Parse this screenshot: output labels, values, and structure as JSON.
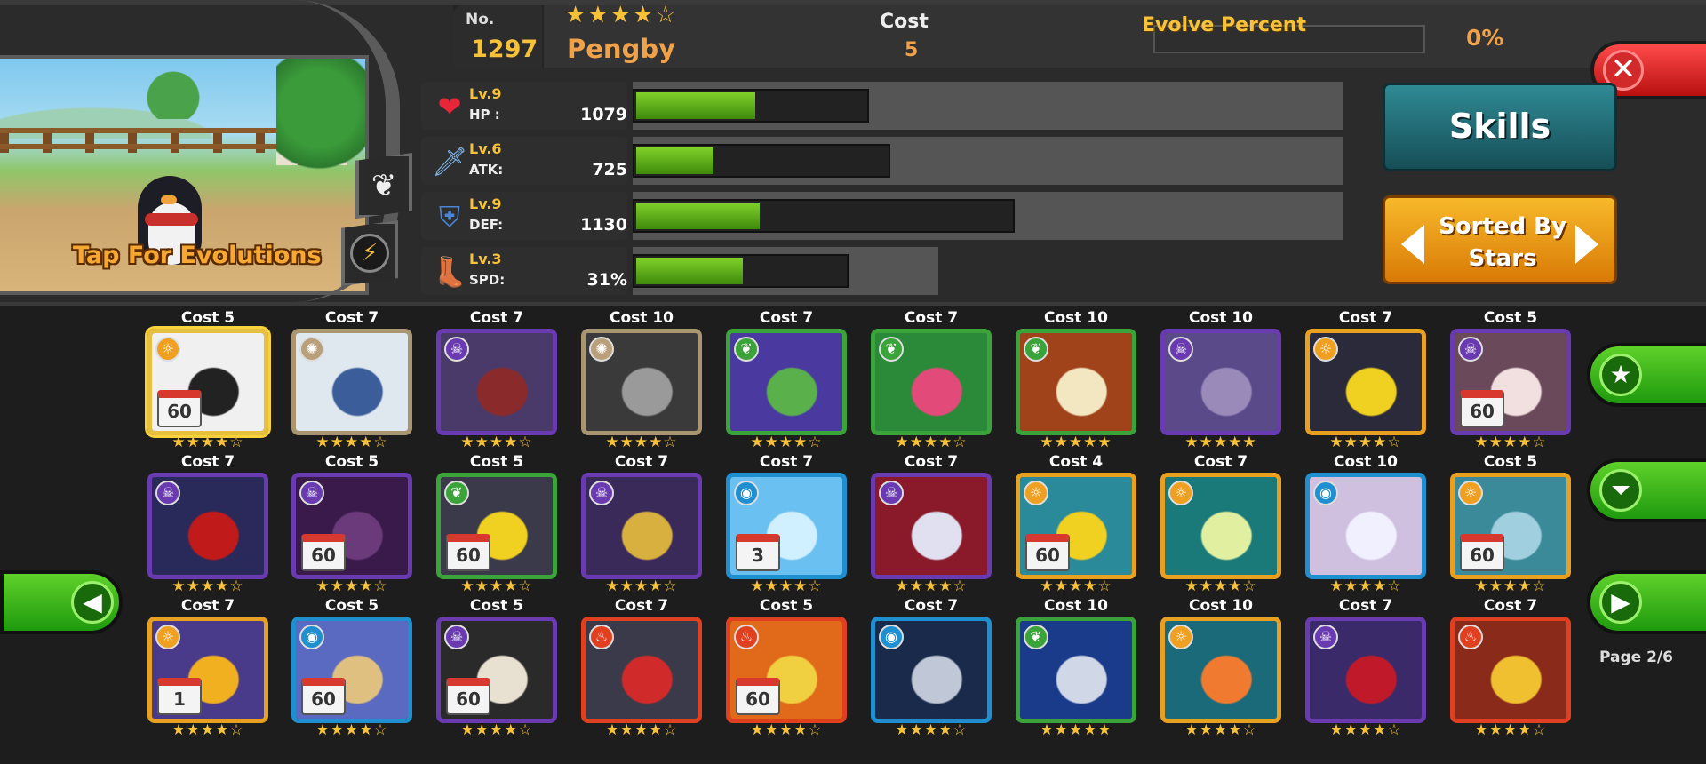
{
  "monster": {
    "no_label": "No.",
    "no": "1297",
    "stars": "★★★★☆",
    "name": "Pengby",
    "cost_label": "Cost",
    "cost": "5",
    "evolve_label": "Evolve Percent",
    "evolve_percent": "0%",
    "evolve_fraction": 0,
    "tap_evolutions": "Tap For Evolutions"
  },
  "stats": [
    {
      "lv": "Lv.9",
      "name": "HP :",
      "value": "1079",
      "icon": "heart-icon",
      "glyph": "❤",
      "color": "#e8263a",
      "fill_fraction": 0.52,
      "bar_fraction": 0.29,
      "track_fraction": 1.0
    },
    {
      "lv": "Lv.6",
      "name": "ATK:",
      "value": "725",
      "icon": "sword-icon",
      "glyph": "🗡",
      "color": "#7fb8f0",
      "fill_fraction": 0.31,
      "bar_fraction": 0.32,
      "track_fraction": 1.0
    },
    {
      "lv": "Lv.9",
      "name": "DEF:",
      "value": "1130",
      "icon": "shield-icon",
      "glyph": "⛨",
      "color": "#4a86d8",
      "fill_fraction": 0.33,
      "bar_fraction": 0.5,
      "track_fraction": 1.0
    },
    {
      "lv": "Lv.3",
      "name": "SPD:",
      "value": "31%",
      "icon": "boot-icon",
      "glyph": "👢",
      "color": "#a0602a",
      "fill_fraction": 0.51,
      "bar_fraction": 0.26,
      "track_fraction": 0.43
    }
  ],
  "buttons": {
    "skills": "Skills",
    "sorted_by_line1": "Sorted By",
    "sorted_by_line2": "Stars",
    "close": "✕"
  },
  "page": "Page 2/6",
  "colors": {
    "water": "#1f8fd0",
    "fire": "#e0401f",
    "light": "#f0a020",
    "dark": "#6a3ab0",
    "nature": "#3aa33a",
    "neutral": "#b9a07a"
  },
  "cards": [
    {
      "cost": "Cost 5",
      "stars": "★★★★☆",
      "element": "light",
      "frame": "#e8c040",
      "art": "#f0f0f0",
      "art2": "#222",
      "badge": "60",
      "selected": true
    },
    {
      "cost": "Cost 7",
      "stars": "★★★★☆",
      "element": "neutral",
      "frame": "#a99570",
      "art": "#dfe8ef",
      "art2": "#3b5e9a",
      "badge": ""
    },
    {
      "cost": "Cost 7",
      "stars": "★★★★☆",
      "element": "dark",
      "frame": "#6a3ab0",
      "art": "#4a3a6a",
      "art2": "#8a2a2a",
      "badge": ""
    },
    {
      "cost": "Cost 10",
      "stars": "★★★★☆",
      "element": "neutral",
      "frame": "#a99570",
      "art": "#3a3a3a",
      "art2": "#9a9a9a",
      "badge": ""
    },
    {
      "cost": "Cost 7",
      "stars": "★★★★☆",
      "element": "nature",
      "frame": "#3aa33a",
      "art": "#4a3aa0",
      "art2": "#5ab04a",
      "badge": ""
    },
    {
      "cost": "Cost 7",
      "stars": "★★★★☆",
      "element": "nature",
      "frame": "#3aa33a",
      "art": "#2a8a3a",
      "art2": "#e24a7a",
      "badge": ""
    },
    {
      "cost": "Cost 10",
      "stars": "★★★★★",
      "element": "nature",
      "frame": "#3aa33a",
      "art": "#a0421a",
      "art2": "#f2e7c0",
      "badge": ""
    },
    {
      "cost": "Cost 10",
      "stars": "★★★★★",
      "element": "dark",
      "frame": "#6a3ab0",
      "art": "#5a4a8a",
      "art2": "#9a8aba",
      "badge": ""
    },
    {
      "cost": "Cost 7",
      "stars": "★★★★☆",
      "element": "light",
      "frame": "#e8a020",
      "art": "#2a2a3a",
      "art2": "#f0d020",
      "badge": ""
    },
    {
      "cost": "Cost 5",
      "stars": "★★★★☆",
      "element": "dark",
      "frame": "#6a3ab0",
      "art": "#6a4a5a",
      "art2": "#f2e0e0",
      "badge": "60"
    },
    {
      "cost": "Cost 7",
      "stars": "★★★★☆",
      "element": "dark",
      "frame": "#6a3ab0",
      "art": "#2a2a5a",
      "art2": "#c01a1a",
      "badge": ""
    },
    {
      "cost": "Cost 5",
      "stars": "★★★★☆",
      "element": "dark",
      "frame": "#6a3ab0",
      "art": "#3a1a4a",
      "art2": "#6a3a7a",
      "badge": "60"
    },
    {
      "cost": "Cost 5",
      "stars": "★★★★☆",
      "element": "nature",
      "frame": "#3aa33a",
      "art": "#3a3a4a",
      "art2": "#f0d020",
      "badge": "60"
    },
    {
      "cost": "Cost 7",
      "stars": "★★★★☆",
      "element": "dark",
      "frame": "#6a3ab0",
      "art": "#3a2a5a",
      "art2": "#d8b040",
      "badge": ""
    },
    {
      "cost": "Cost 7",
      "stars": "★★★★☆",
      "element": "water",
      "frame": "#1f8fd0",
      "art": "#6ac0f0",
      "art2": "#d0f0ff",
      "badge": "3"
    },
    {
      "cost": "Cost 7",
      "stars": "★★★★☆",
      "element": "dark",
      "frame": "#6a3ab0",
      "art": "#8a1a2a",
      "art2": "#e0e0f0",
      "badge": ""
    },
    {
      "cost": "Cost 4",
      "stars": "★★★★☆",
      "element": "light",
      "frame": "#e8a020",
      "art": "#2a8a9a",
      "art2": "#f0d020",
      "badge": "60"
    },
    {
      "cost": "Cost 7",
      "stars": "★★★★☆",
      "element": "light",
      "frame": "#e8a020",
      "art": "#1a7a7a",
      "art2": "#e0f0a0",
      "badge": ""
    },
    {
      "cost": "Cost 10",
      "stars": "★★★★☆",
      "element": "water",
      "frame": "#1f8fd0",
      "art": "#d0c0e0",
      "art2": "#f0f0ff",
      "badge": ""
    },
    {
      "cost": "Cost 5",
      "stars": "★★★★☆",
      "element": "light",
      "frame": "#e8a020",
      "art": "#3a8a9a",
      "art2": "#a0d0e0",
      "badge": "60"
    },
    {
      "cost": "Cost 7",
      "stars": "★★★★☆",
      "element": "light",
      "frame": "#e8a020",
      "art": "#4a3a8a",
      "art2": "#f0b020",
      "badge": "1"
    },
    {
      "cost": "Cost 5",
      "stars": "★★★★☆",
      "element": "water",
      "frame": "#1f8fd0",
      "art": "#5a6ac0",
      "art2": "#e0c080",
      "badge": "60"
    },
    {
      "cost": "Cost 5",
      "stars": "★★★★☆",
      "element": "dark",
      "frame": "#6a3ab0",
      "art": "#2a2a2a",
      "art2": "#e8e0d0",
      "badge": "60"
    },
    {
      "cost": "Cost 7",
      "stars": "★★★★☆",
      "element": "fire",
      "frame": "#e0401f",
      "art": "#3a3a4a",
      "art2": "#d02a2a",
      "badge": ""
    },
    {
      "cost": "Cost 5",
      "stars": "★★★★☆",
      "element": "fire",
      "frame": "#e0401f",
      "art": "#e06a1a",
      "art2": "#f0d040",
      "badge": "60"
    },
    {
      "cost": "Cost 7",
      "stars": "★★★★☆",
      "element": "water",
      "frame": "#1f8fd0",
      "art": "#1a2a4a",
      "art2": "#c0c8d8",
      "badge": ""
    },
    {
      "cost": "Cost 10",
      "stars": "★★★★★",
      "element": "nature",
      "frame": "#3aa33a",
      "art": "#1a3a8a",
      "art2": "#d0d8e8",
      "badge": ""
    },
    {
      "cost": "Cost 10",
      "stars": "★★★★☆",
      "element": "light",
      "frame": "#e8a020",
      "art": "#1a6a7a",
      "art2": "#f07a30",
      "badge": ""
    },
    {
      "cost": "Cost 7",
      "stars": "★★★★☆",
      "element": "dark",
      "frame": "#6a3ab0",
      "art": "#3a2a6a",
      "art2": "#c01a2a",
      "badge": ""
    },
    {
      "cost": "Cost 7",
      "stars": "★★★★☆",
      "element": "fire",
      "frame": "#e0401f",
      "art": "#8a2a1a",
      "art2": "#f0c030",
      "badge": ""
    }
  ]
}
